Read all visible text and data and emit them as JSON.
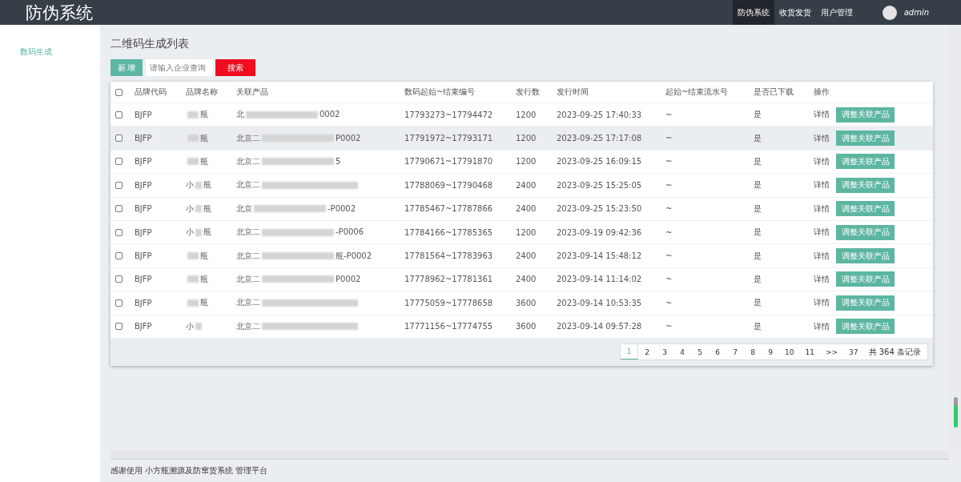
{
  "header": {
    "logo": "防伪系统",
    "nav": [
      {
        "label": "防伪系统",
        "selected": true
      },
      {
        "label": "收货发货",
        "selected": false
      },
      {
        "label": "用户管理",
        "selected": false
      }
    ],
    "user": "admin"
  },
  "sidebar": {
    "items": [
      {
        "label": "数码生成",
        "selected": true
      }
    ]
  },
  "page_title": "二维码生成列表",
  "toolbar": {
    "add_button": "新 增",
    "search": {
      "placeholder": "请输入企业查询"
    },
    "search_button": "搜索"
  },
  "table": {
    "select_all": {
      "checked": false
    },
    "columns": [
      "品牌代码",
      "品牌名称",
      "关联产品",
      "数码起始~结束编号",
      "发行数",
      "发行时间",
      "起始~结束流水号",
      "是否已下载",
      "操作"
    ],
    "rows": [
      {
        "checked": false,
        "highlighted": false,
        "code": "BJFP",
        "name_end": "瓶",
        "product_start": "北",
        "product_end": "0002",
        "range": "17793273~17794472",
        "count": "1200",
        "time": "2023-09-25 17:40:33",
        "serial": "~",
        "downloaded": "是",
        "detail": "详情",
        "action": "调整关联产品"
      },
      {
        "checked": false,
        "highlighted": true,
        "code": "BJFP",
        "name_end": "瓶",
        "product_start": "北京二",
        "product_end": "P0002",
        "range": "17791972~17793171",
        "count": "1200",
        "time": "2023-09-25 17:17:08",
        "serial": "~",
        "downloaded": "是",
        "detail": "详情",
        "action": "调整关联产品"
      },
      {
        "checked": false,
        "highlighted": false,
        "code": "BJFP",
        "name_end": "瓶",
        "product_start": "北京二",
        "product_end": "5",
        "range": "17790671~17791870",
        "count": "1200",
        "time": "2023-09-25 16:09:15",
        "serial": "~",
        "downloaded": "是",
        "detail": "详情",
        "action": "调整关联产品"
      },
      {
        "checked": false,
        "highlighted": false,
        "code": "BJFP",
        "name_start": "小",
        "name_end": "瓶",
        "product_start": "北京二",
        "range": "17788069~17790468",
        "count": "2400",
        "time": "2023-09-25 15:25:05",
        "serial": "~",
        "downloaded": "是",
        "detail": "详情",
        "action": "调整关联产品"
      },
      {
        "checked": false,
        "highlighted": false,
        "code": "BJFP",
        "name_start": "小",
        "name_end": "瓶",
        "product_start": "北京",
        "product_end": "-P0002",
        "range": "17785467~17787866",
        "count": "2400",
        "time": "2023-09-25 15:23:50",
        "serial": "~",
        "downloaded": "是",
        "detail": "详情",
        "action": "调整关联产品"
      },
      {
        "checked": false,
        "highlighted": false,
        "code": "BJFP",
        "name_start": "小",
        "name_end": "瓶",
        "product_start": "北京二",
        "product_end": "-P0006",
        "range": "17784166~17785365",
        "count": "1200",
        "time": "2023-09-19 09:42:36",
        "serial": "~",
        "downloaded": "是",
        "detail": "详情",
        "action": "调整关联产品"
      },
      {
        "checked": false,
        "highlighted": false,
        "code": "BJFP",
        "name_end": "瓶",
        "product_start": "北京二",
        "product_end": "瓶-P0002",
        "range": "17781564~17783963",
        "count": "2400",
        "time": "2023-09-14 15:48:12",
        "serial": "~",
        "downloaded": "是",
        "detail": "详情",
        "action": "调整关联产品"
      },
      {
        "checked": false,
        "highlighted": false,
        "code": "BJFP",
        "name_end": "瓶",
        "product_start": "北京二",
        "product_end": "P0002",
        "range": "17778962~17781361",
        "count": "2400",
        "time": "2023-09-14 11:14:02",
        "serial": "~",
        "downloaded": "是",
        "detail": "详情",
        "action": "调整关联产品"
      },
      {
        "checked": false,
        "highlighted": false,
        "code": "BJFP",
        "name_end": "瓶",
        "product_start": "北京二",
        "range": "17775059~17778658",
        "count": "3600",
        "time": "2023-09-14 10:53:35",
        "serial": "~",
        "downloaded": "是",
        "detail": "详情",
        "action": "调整关联产品"
      },
      {
        "checked": false,
        "highlighted": false,
        "code": "BJFP",
        "name_start": "小",
        "product_start": "北京二",
        "range": "17771156~17774755",
        "count": "3600",
        "time": "2023-09-14 09:57:28",
        "serial": "~",
        "downloaded": "是",
        "detail": "详情",
        "action": "调整关联产品"
      }
    ]
  },
  "pagination": {
    "pages": [
      {
        "label": "1",
        "selected": true
      },
      {
        "label": "2",
        "selected": false
      },
      {
        "label": "3",
        "selected": false
      },
      {
        "label": "4",
        "selected": false
      },
      {
        "label": "5",
        "selected": false
      },
      {
        "label": "6",
        "selected": false
      },
      {
        "label": "7",
        "selected": false
      },
      {
        "label": "8",
        "selected": false
      },
      {
        "label": "9",
        "selected": false
      },
      {
        "label": "10",
        "selected": false
      },
      {
        "label": "11",
        "selected": false
      },
      {
        "label": ">>",
        "selected": false
      },
      {
        "label": "37",
        "selected": false
      }
    ],
    "total": "共 364 条记录"
  },
  "footer": "感谢使用 小方瓶溯源及防窜货系统 管理平台"
}
